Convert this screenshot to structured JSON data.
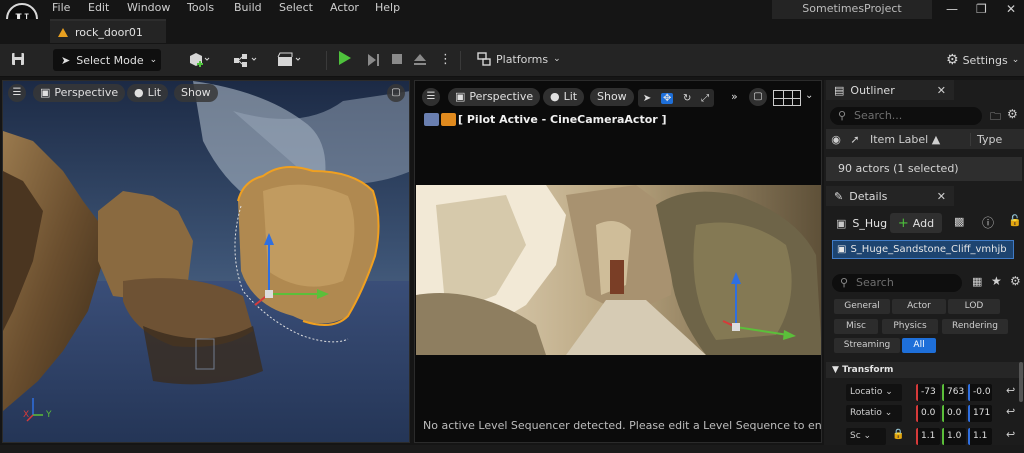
{
  "menu": {
    "logo_letter": "U",
    "items": [
      "File",
      "Edit",
      "Window",
      "Tools",
      "Build",
      "Select",
      "Actor",
      "Help"
    ],
    "project": "SometimesProject"
  },
  "tab": {
    "label": "rock_door01"
  },
  "toolbar": {
    "select_mode": "Select Mode",
    "platforms": "Platforms",
    "settings": "Settings"
  },
  "left_viewport": {
    "view_mode": "Perspective",
    "lit": "Lit",
    "show": "Show",
    "axis_x": "X",
    "axis_y": "Y"
  },
  "right_viewport": {
    "view_mode": "Perspective",
    "lit": "Lit",
    "show": "Show",
    "pilot": "[ Pilot Active - CineCameraActor ]",
    "sequencer_message": "No active Level Sequencer detected. Please edit a Level Sequence to enable ful"
  },
  "outliner": {
    "tab_label": "Outliner",
    "search_placeholder": "Search...",
    "col_item_label": "Item Label",
    "col_type": "Type",
    "actor_count": "90 actors (1 selected)"
  },
  "details": {
    "tab_label": "Details",
    "actor_short": "S_Hug",
    "add_label": "Add",
    "selected_component": "S_Huge_Sandstone_Cliff_vmhjb",
    "search_placeholder": "Search",
    "filters": [
      "General",
      "Actor",
      "LOD",
      "Misc",
      "Physics",
      "Rendering",
      "Streaming",
      "All"
    ],
    "transform_label": "Transform",
    "location": {
      "label": "Locatio",
      "x": "-73",
      "y": "763",
      "z": "-0.0"
    },
    "rotation": {
      "label": "Rotatio",
      "x": "0.0",
      "y": "0.0",
      "z": "171"
    },
    "scale": {
      "label": "Sc",
      "x": "1.1",
      "y": "1.0",
      "z": "1.1"
    }
  },
  "colors": {
    "accent_blue": "#1e6fd9",
    "play_green": "#4ec23c",
    "selection_orange": "#f0a020",
    "axis_red": "#d63a3a",
    "axis_green": "#5bbf3a",
    "axis_blue": "#2f6fe0"
  },
  "icons": {
    "save": "save-icon",
    "hamburger": "menu-icon",
    "perspective": "cube-icon",
    "lit": "sun-icon",
    "search": "search-icon",
    "close": "close-icon",
    "eye": "eye-icon",
    "pin": "pin-icon",
    "settings": "gear-icon",
    "reset": "reset-icon",
    "lock": "lock-icon",
    "maximize": "maximize-icon",
    "help": "help-icon"
  }
}
